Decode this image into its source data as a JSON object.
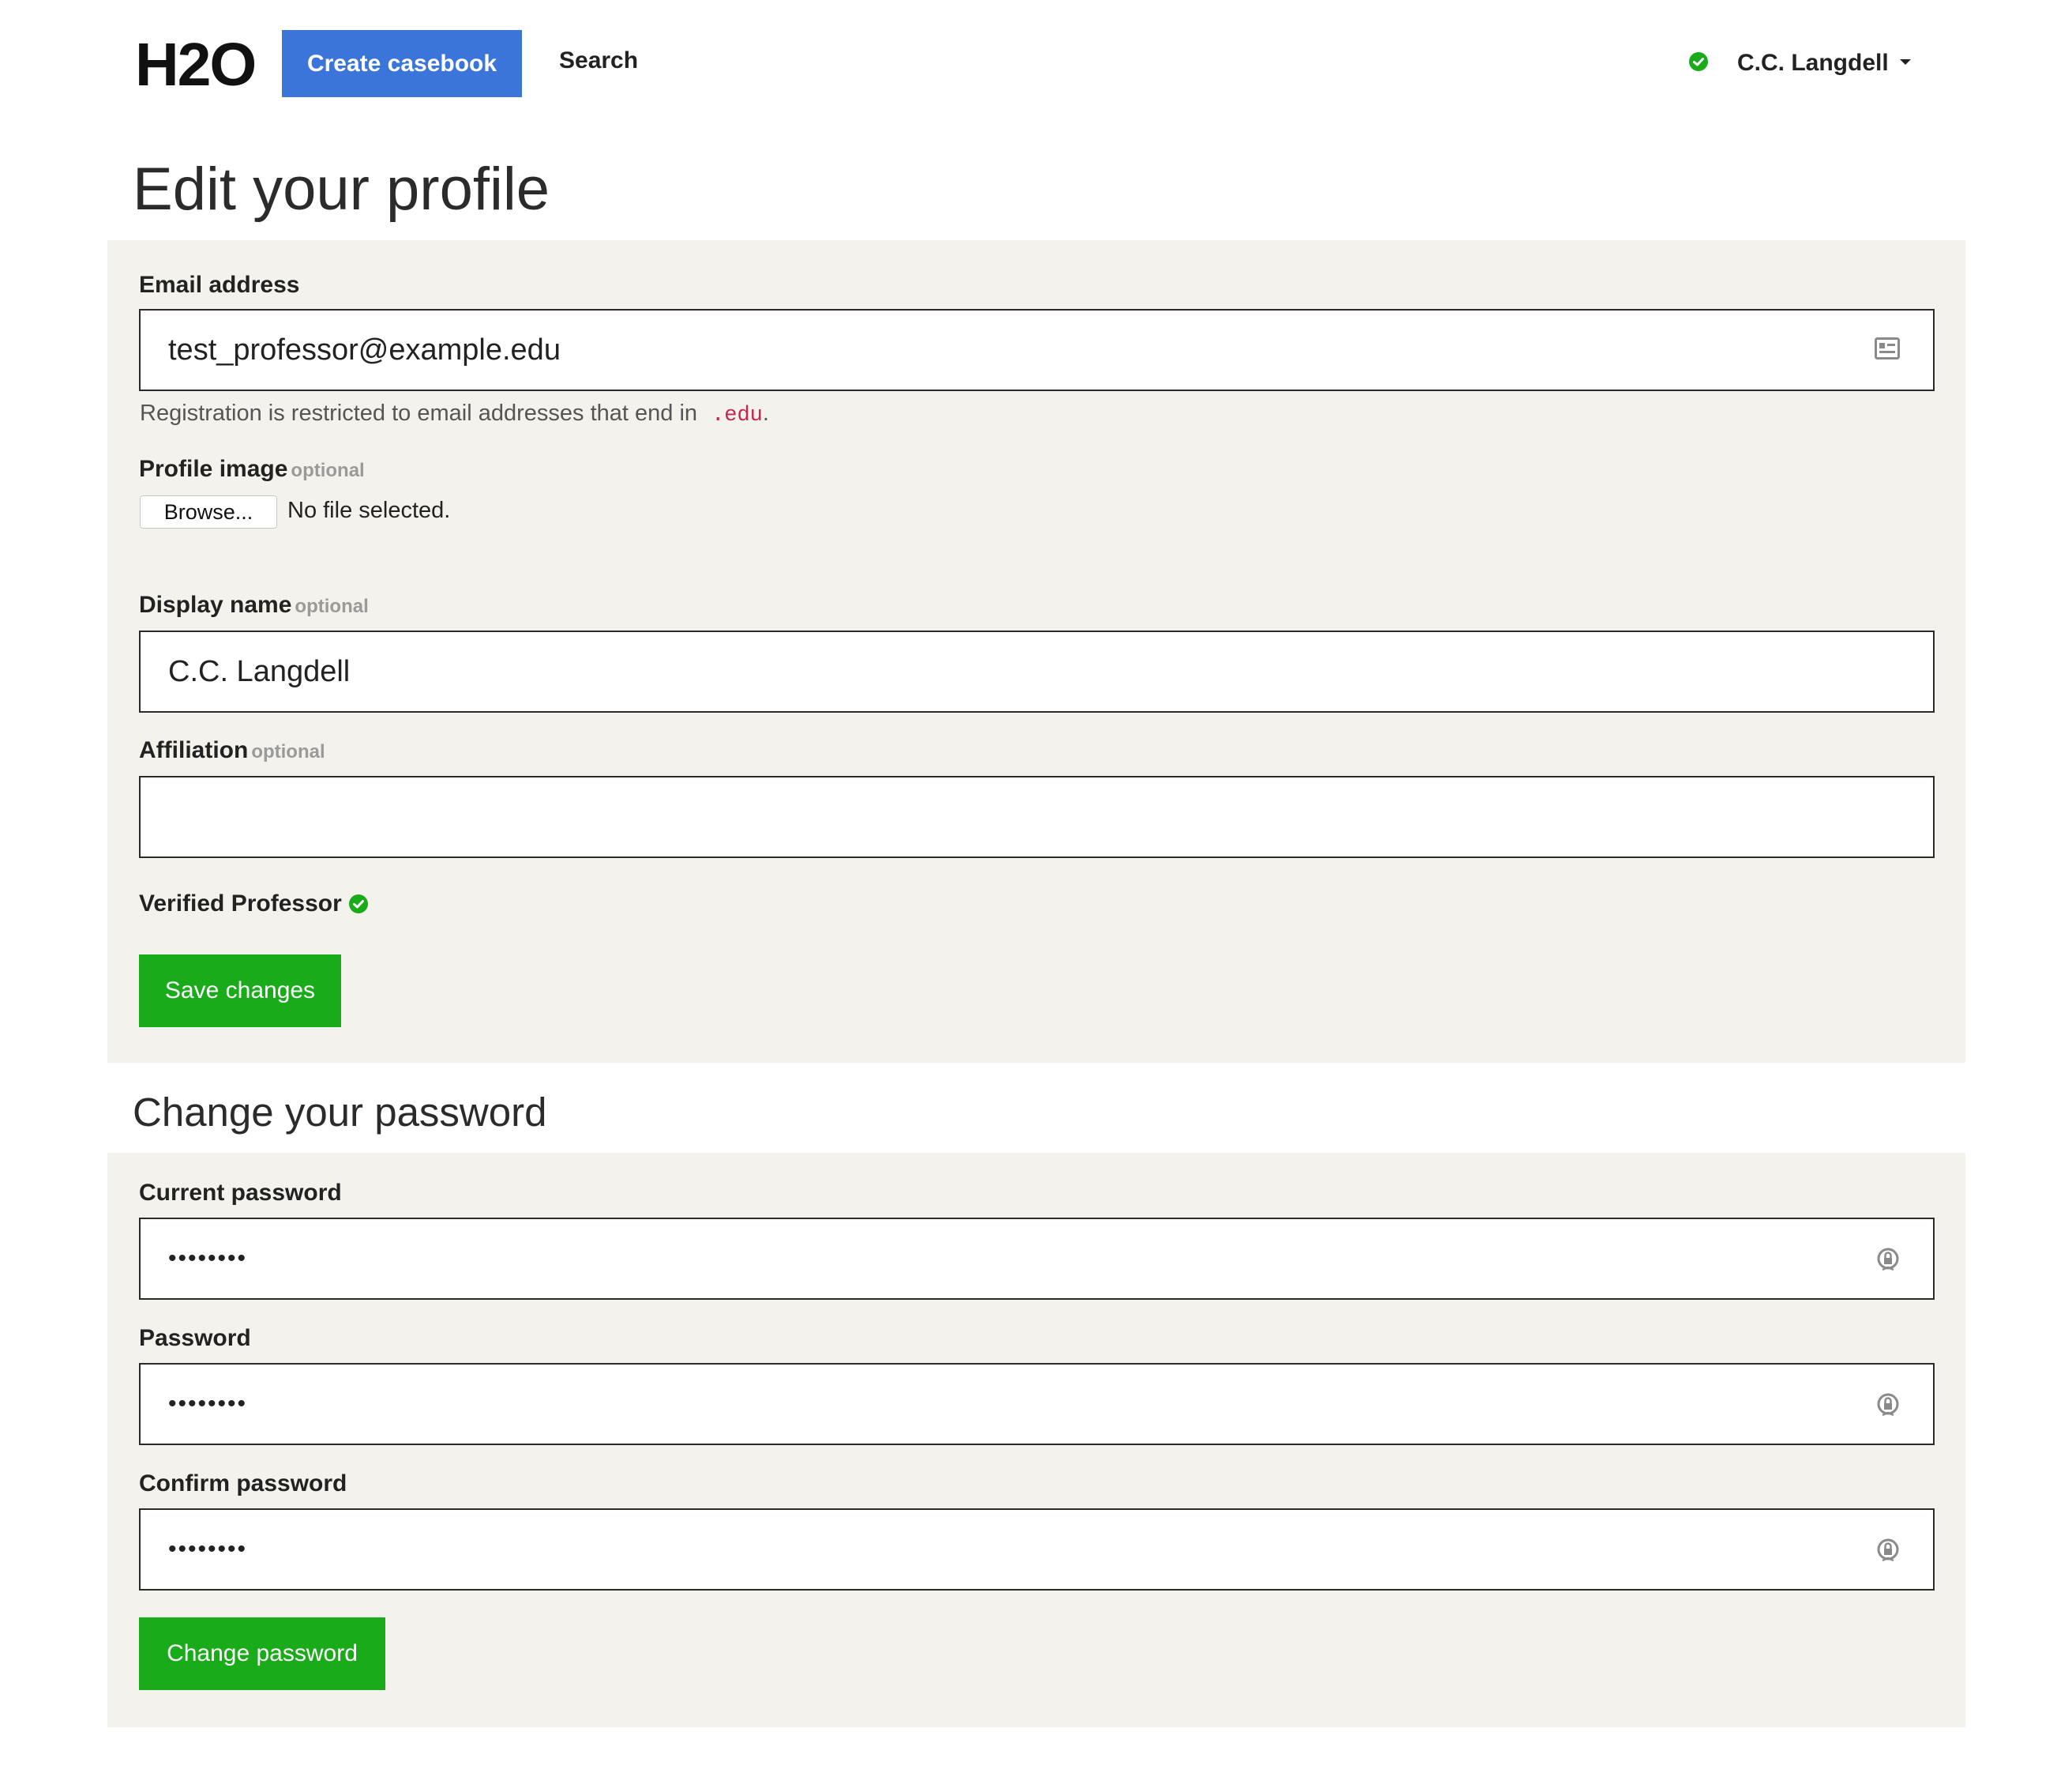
{
  "header": {
    "logo": "H2O",
    "create_label": "Create casebook",
    "search_label": "Search",
    "user_name": "C.C. Langdell",
    "status_color": "#19ab19",
    "accent_color": "#3b75d9"
  },
  "profile": {
    "title": "Edit your profile",
    "email": {
      "label": "Email address",
      "value": "test_professor@example.edu",
      "help_text": "Registration is restricted to email addresses that end in",
      "help_code": ".edu",
      "help_end": "."
    },
    "image": {
      "label": "Profile image",
      "optional": "optional",
      "browse_label": "Browse...",
      "file_status": "No file selected."
    },
    "display_name": {
      "label": "Display name",
      "optional": "optional",
      "value": "C.C. Langdell"
    },
    "affiliation": {
      "label": "Affiliation",
      "optional": "optional",
      "value": ""
    },
    "verified_label": "Verified Professor",
    "save_label": "Save changes"
  },
  "password": {
    "title": "Change your password",
    "current": {
      "label": "Current password",
      "value": "••••••••"
    },
    "new": {
      "label": "Password",
      "value": "••••••••"
    },
    "confirm": {
      "label": "Confirm password",
      "value": "••••••••"
    },
    "change_label": "Change password"
  },
  "icons": {
    "email_field": "contact-card-icon",
    "password_fields": "password-lock-icon",
    "verified": "check-circle-icon",
    "user_menu": "chevron-down-icon"
  },
  "colors": {
    "panel_bg": "#f3f2ec",
    "action_green": "#19ab19",
    "code_red": "#c7254e"
  }
}
